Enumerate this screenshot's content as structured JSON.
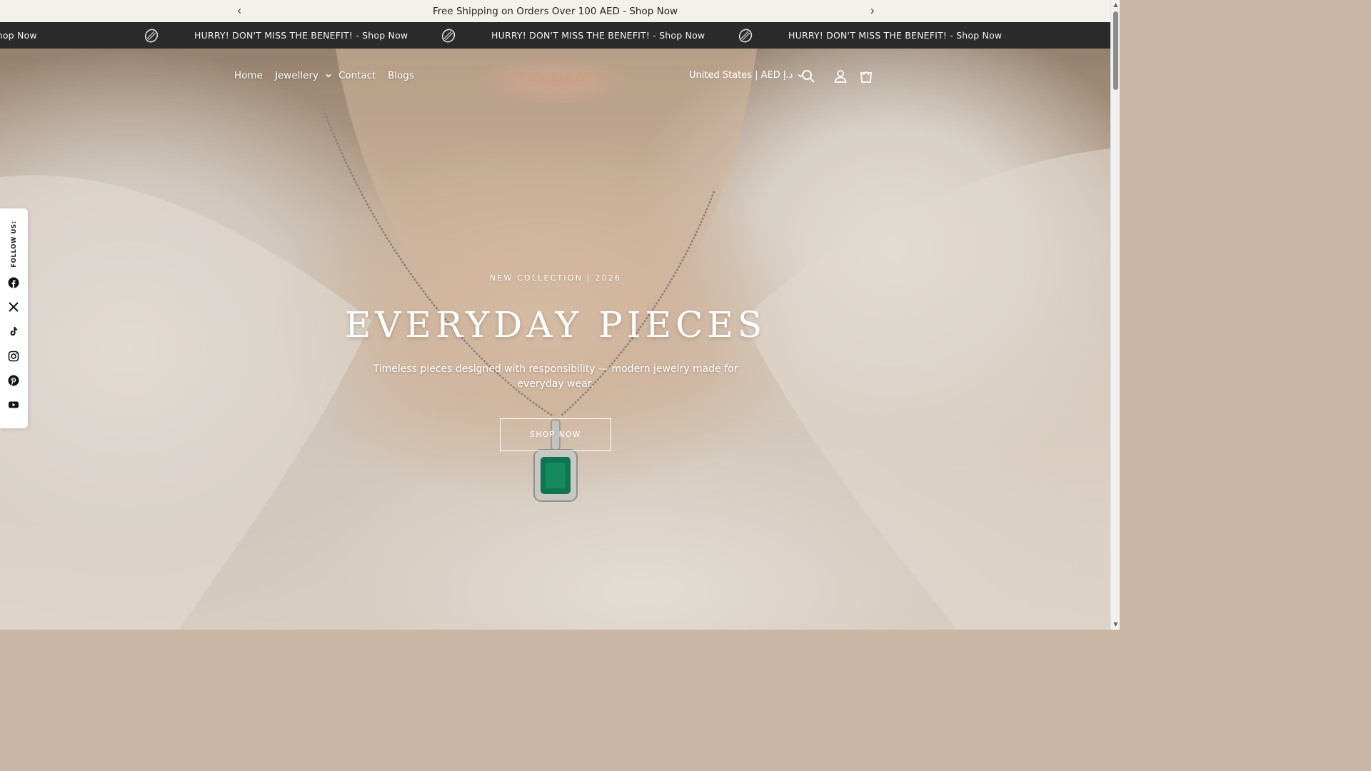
{
  "announcement": {
    "text": "Free Shipping on Orders Over 100 AED - Shop Now",
    "prev_icon": "chevron-left-icon",
    "next_icon": "chevron-right-icon"
  },
  "marquee": {
    "items": [
      "FIT! - Shop Now",
      "HURRY! DON'T MISS THE BENEFIT! - Shop Now",
      "HURRY! DON'T MISS THE BENEFIT! - Shop Now",
      "HURRY! DON'T MISS THE BENEFIT! - Shop Now"
    ],
    "separator_icon": "ring-icon"
  },
  "header": {
    "nav": [
      {
        "label": "Home"
      },
      {
        "label": "Jewellery",
        "dropdown": true
      },
      {
        "label": "Contact"
      },
      {
        "label": "Blogs"
      }
    ],
    "logo": "emeriene",
    "region": "United States | AED د.إ",
    "icons": [
      "search-icon",
      "account-icon",
      "cart-icon"
    ]
  },
  "social": {
    "label": "FOLLOW US:",
    "icons": [
      "facebook-icon",
      "x-icon",
      "tiktok-icon",
      "instagram-icon",
      "pinterest-icon",
      "youtube-icon"
    ]
  },
  "hero": {
    "eyebrow": "NEW COLLECTION | 2026",
    "title": "EVERYDAY PIECES",
    "subtitle": "Timeless pieces designed with responsibility — modern jewelry made for everyday wear.",
    "cta": "SHOP NOW"
  },
  "colors": {
    "announcement_bg": "#f4f0ec",
    "marquee_bg": "#2b2b2b",
    "logo": "#c7a27a",
    "emerald": "#0d7a55"
  }
}
